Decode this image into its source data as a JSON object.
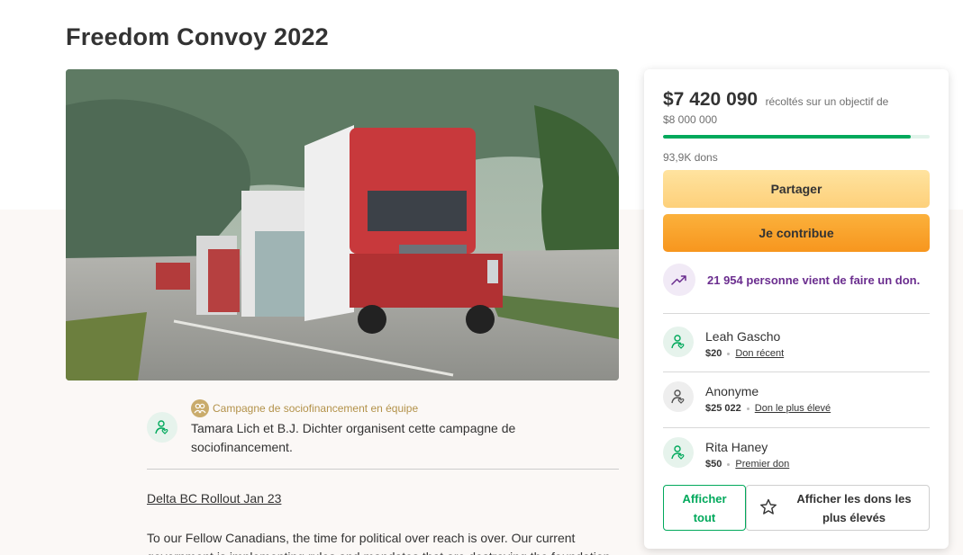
{
  "page": {
    "title": "Freedom Convoy 2022"
  },
  "campaign": {
    "team_label": "Campagne de sociofinancement en équipe",
    "organizer_text": "Tamara Lich et B.J. Dichter organisent cette campagne de sociofinancement.",
    "story_heading": "Delta BC Rollout Jan 23",
    "story_text": "To our Fellow Canadians, the time for political over reach is over.  Our current government is implementing rules and mandates that are destroying the foundation"
  },
  "donation_card": {
    "raised": "$7 420 090",
    "raised_suffix": "récoltés sur un objectif de",
    "goal": "$8 000 000",
    "progress_fraction": 0.9275,
    "donation_count": "93,9K dons",
    "share_label": "Partager",
    "give_label": "Je contribue",
    "recent_activity": "21 954 personne vient de faire un don.",
    "donors": [
      {
        "name": "Leah Gascho",
        "amount": "$20",
        "tag": "Don récent"
      },
      {
        "name": "Anonyme",
        "amount": "$25 022",
        "tag": "Don le plus élevé"
      },
      {
        "name": "Rita Haney",
        "amount": "$50",
        "tag": "Premier don"
      }
    ],
    "see_all_label": "Afficher tout",
    "see_top_label": "Afficher les dons les plus élevés"
  },
  "colors": {
    "accent_green": "#02a95c",
    "recent_purple": "#6b2e8f",
    "give_orange": "#f7961e",
    "share_yellow": "#fdd07a",
    "team_gold": "#b3924a"
  },
  "icons": {
    "team": "team-icon",
    "organizer": "person-heart-icon",
    "trend": "trending-up-icon",
    "star": "star-icon"
  }
}
